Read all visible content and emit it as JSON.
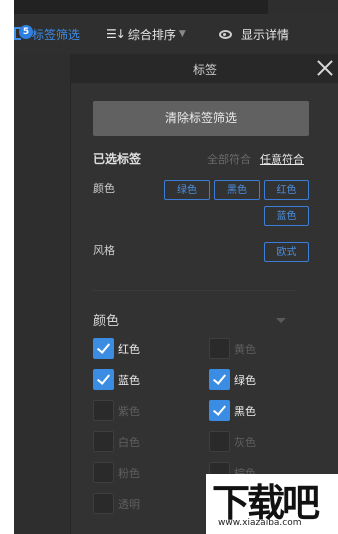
{
  "toolbar": {
    "filter_badge": "5",
    "filter_label": "标签筛选",
    "sort_label": "综合排序",
    "sort_icon": "sort-descending-icon",
    "detail_label": "显示详情",
    "detail_icon": "eye-icon"
  },
  "panel": {
    "title": "标签",
    "clear_button": "清除标签筛选",
    "selected_title": "已选标签",
    "match_all": "全部符合",
    "match_any": "任意符合",
    "rows": [
      {
        "label": "颜色",
        "chips": [
          "绿色",
          "黑色",
          "红色",
          "蓝色"
        ]
      },
      {
        "label": "风格",
        "chips": [
          "欧式"
        ]
      }
    ]
  },
  "color_section": {
    "title": "颜色",
    "options": [
      {
        "label": "红色",
        "checked": true
      },
      {
        "label": "黄色",
        "checked": false
      },
      {
        "label": "蓝色",
        "checked": true
      },
      {
        "label": "绿色",
        "checked": true
      },
      {
        "label": "紫色",
        "checked": false
      },
      {
        "label": "黑色",
        "checked": true
      },
      {
        "label": "白色",
        "checked": false
      },
      {
        "label": "灰色",
        "checked": false
      },
      {
        "label": "粉色",
        "checked": false
      },
      {
        "label": "棕色",
        "checked": false
      },
      {
        "label": "透明",
        "checked": false
      }
    ]
  },
  "colors": {
    "accent": "#3b8de4",
    "panel_bg": "#323232",
    "header_bg": "#282828"
  },
  "watermark": {
    "text": "下载吧",
    "url": "www.xiazaiba.com"
  }
}
